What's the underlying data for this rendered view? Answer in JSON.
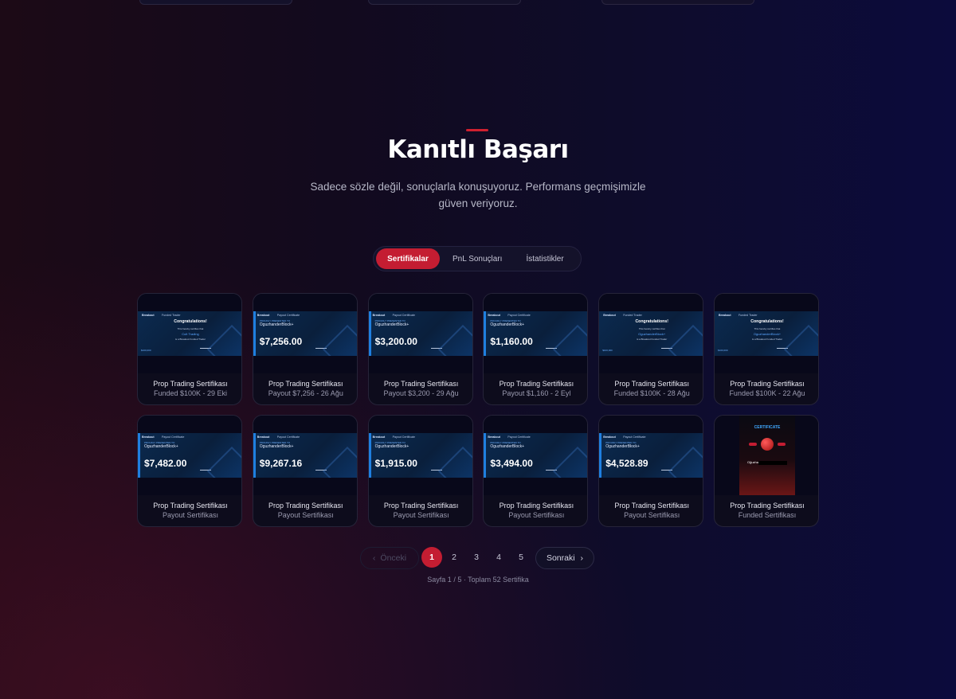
{
  "section": {
    "title": "Kanıtlı Başarı",
    "subtitle": "Sadece sözle değil, sonuçlarla konuşuyoruz. Performans geçmişimizle güven veriyoruz."
  },
  "tabs": [
    {
      "label": "Sertifikalar",
      "active": true
    },
    {
      "label": "PnL Sonuçları",
      "active": false
    },
    {
      "label": "İstatistikler",
      "active": false
    }
  ],
  "certificate_brand": "Breakout",
  "certificate_labels": {
    "funded_kind": "Funded Trader",
    "payout_kind": "Payout Certificate",
    "presented_to": "PROUDLY PRESENTED TO",
    "congrats": "Congratulations!",
    "certify": "This hereby certifies that",
    "funded_line": "is a Breakout Funded Trader"
  },
  "cards": [
    {
      "type": "funded",
      "trader": "Cult Trading",
      "account": "$100,000",
      "title": "Prop Trading Sertifikası",
      "subtitle": "Funded $100K - 29 Eki"
    },
    {
      "type": "payout",
      "name": "OguzhanderBlock+",
      "amount": "$7,256.00",
      "title": "Prop Trading Sertifikası",
      "subtitle": "Payout $7,256 - 26 Ağu"
    },
    {
      "type": "payout",
      "name": "OguzhanderBlock+",
      "amount": "$3,200.00",
      "title": "Prop Trading Sertifikası",
      "subtitle": "Payout $3,200 - 29 Ağu"
    },
    {
      "type": "payout",
      "name": "OguzhanderBlock+",
      "amount": "$1,160.00",
      "title": "Prop Trading Sertifikası",
      "subtitle": "Payout $1,160 - 2 Eyl"
    },
    {
      "type": "funded",
      "trader": "OguzhanderBlock+",
      "account": "$100,000",
      "title": "Prop Trading Sertifikası",
      "subtitle": "Funded $100K - 28 Ağu"
    },
    {
      "type": "funded",
      "trader": "OguzhanderBlock+",
      "account": "$100,000",
      "title": "Prop Trading Sertifikası",
      "subtitle": "Funded $100K - 22 Ağu"
    },
    {
      "type": "payout",
      "name": "OguzhanderBlock+",
      "amount": "$7,482.00",
      "title": "Prop Trading Sertifikası",
      "subtitle": "Payout Sertifikası"
    },
    {
      "type": "payout",
      "name": "OguzhanderBlock+",
      "amount": "$9,267.16",
      "title": "Prop Trading Sertifikası",
      "subtitle": "Payout Sertifikası"
    },
    {
      "type": "payout",
      "name": "OguzhanderBlock+",
      "amount": "$1,915.00",
      "title": "Prop Trading Sertifikası",
      "subtitle": "Payout Sertifikası"
    },
    {
      "type": "payout",
      "name": "OguzhanderBlock+",
      "amount": "$3,494.00",
      "title": "Prop Trading Sertifikası",
      "subtitle": "Payout Sertifikası"
    },
    {
      "type": "payout",
      "name": "OguzhanderBlock+",
      "amount": "$4,528.89",
      "title": "Prop Trading Sertifikası",
      "subtitle": "Payout Sertifikası"
    },
    {
      "type": "red",
      "rc_title": "CERTIFICATE",
      "rc_name": "Oğuzhan",
      "title": "Prop Trading Sertifikası",
      "subtitle": "Funded Sertifikası"
    }
  ],
  "pagination": {
    "prev_label": "Önceki",
    "next_label": "Sonraki",
    "pages": [
      "1",
      "2",
      "3",
      "4",
      "5"
    ],
    "current": "1",
    "info": "Sayfa 1 / 5 · Toplam 52 Sertifika"
  },
  "colors": {
    "accent": "#c41d32",
    "card_bg": "#0d0c1c",
    "cert_blue": "#0b2a4f",
    "cert_stripe": "#1f7fe0"
  }
}
